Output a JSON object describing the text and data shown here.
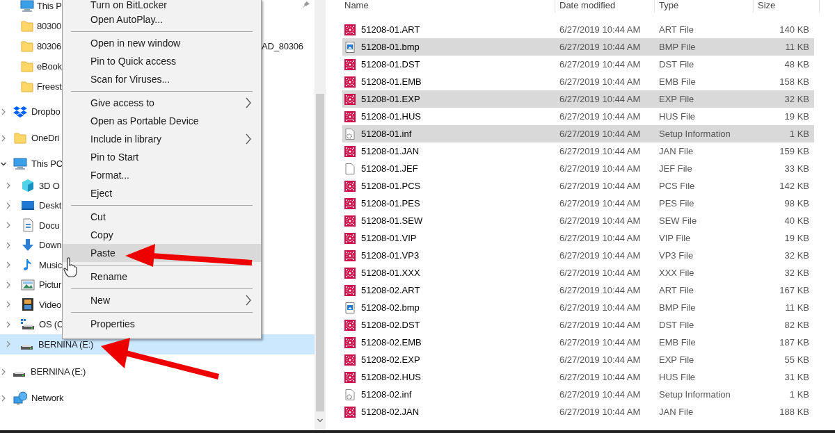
{
  "navigation": {
    "quick_access_items": [
      {
        "kind": "pc",
        "label": "This P"
      },
      {
        "kind": "folder",
        "label": "80300"
      },
      {
        "kind": "folder",
        "label": "80306",
        "tail": "AD_80306"
      },
      {
        "kind": "folder",
        "label": "eBook"
      },
      {
        "kind": "folder",
        "label": "Freest"
      }
    ],
    "tree": [
      {
        "kind": "dropbox",
        "label": "Dropbo",
        "expanded": false,
        "selected": false
      },
      {
        "kind": "folder",
        "label": "OneDri",
        "expanded": false,
        "selected": false
      },
      {
        "kind": "pc",
        "label": "This PC",
        "expanded": true,
        "selected": false,
        "children": [
          {
            "kind": "cube",
            "label": "3D O",
            "selected": false
          },
          {
            "kind": "desktop",
            "label": "Deskt",
            "selected": false
          },
          {
            "kind": "documents",
            "label": "Docu",
            "selected": false
          },
          {
            "kind": "downloads",
            "label": "Down",
            "selected": false
          },
          {
            "kind": "music",
            "label": "Music",
            "selected": false
          },
          {
            "kind": "pictures",
            "label": "Pictur",
            "selected": false
          },
          {
            "kind": "videos",
            "label": "Video",
            "selected": false
          },
          {
            "kind": "osdrive",
            "label": "OS (C",
            "selected": false
          },
          {
            "kind": "drive",
            "label": "BERNINA (E:)",
            "selected": true
          }
        ]
      },
      {
        "kind": "drive",
        "label": "BERNINA (E:)",
        "expanded": false,
        "selected": false
      },
      {
        "kind": "network",
        "label": "Network",
        "expanded": false,
        "selected": false
      }
    ]
  },
  "context_menu": [
    {
      "kind": "item",
      "label": "Turn on BitLocker",
      "submenu": false,
      "highlighted": false
    },
    {
      "kind": "item",
      "label": "Open AutoPlay...",
      "submenu": false,
      "highlighted": false
    },
    {
      "kind": "separator"
    },
    {
      "kind": "item",
      "label": "Open in new window",
      "submenu": false,
      "highlighted": false
    },
    {
      "kind": "item",
      "label": "Pin to Quick access",
      "submenu": false,
      "highlighted": false
    },
    {
      "kind": "item",
      "label": "Scan for Viruses...",
      "submenu": false,
      "highlighted": false
    },
    {
      "kind": "separator"
    },
    {
      "kind": "item",
      "label": "Give access to",
      "submenu": true,
      "highlighted": false
    },
    {
      "kind": "item",
      "label": "Open as Portable Device",
      "submenu": false,
      "highlighted": false
    },
    {
      "kind": "item",
      "label": "Include in library",
      "submenu": true,
      "highlighted": false
    },
    {
      "kind": "item",
      "label": "Pin to Start",
      "submenu": false,
      "highlighted": false
    },
    {
      "kind": "item",
      "label": "Format...",
      "submenu": false,
      "highlighted": false
    },
    {
      "kind": "item",
      "label": "Eject",
      "submenu": false,
      "highlighted": false
    },
    {
      "kind": "separator"
    },
    {
      "kind": "item",
      "label": "Cut",
      "submenu": false,
      "highlighted": false
    },
    {
      "kind": "item",
      "label": "Copy",
      "submenu": false,
      "highlighted": false
    },
    {
      "kind": "item",
      "label": "Paste",
      "submenu": false,
      "highlighted": true
    },
    {
      "kind": "separator"
    },
    {
      "kind": "item",
      "label": "Rename",
      "submenu": false,
      "highlighted": false
    },
    {
      "kind": "separator"
    },
    {
      "kind": "item",
      "label": "New",
      "submenu": true,
      "highlighted": false
    },
    {
      "kind": "separator"
    },
    {
      "kind": "item",
      "label": "Properties",
      "submenu": false,
      "highlighted": false
    }
  ],
  "file_list": {
    "columns": [
      "Name",
      "Date modified",
      "Type",
      "Size"
    ],
    "rows": [
      {
        "kind": "embroidery",
        "name": "51208-01.ART",
        "date": "6/27/2019 10:44 AM",
        "type": "ART File",
        "size": "140 KB",
        "selected": false
      },
      {
        "kind": "bitmap",
        "name": "51208-01.bmp",
        "date": "6/27/2019 10:44 AM",
        "type": "BMP File",
        "size": "11 KB",
        "selected": true
      },
      {
        "kind": "embroidery",
        "name": "51208-01.DST",
        "date": "6/27/2019 10:44 AM",
        "type": "DST File",
        "size": "48 KB",
        "selected": false
      },
      {
        "kind": "embroidery",
        "name": "51208-01.EMB",
        "date": "6/27/2019 10:44 AM",
        "type": "EMB File",
        "size": "158 KB",
        "selected": false
      },
      {
        "kind": "embroidery",
        "name": "51208-01.EXP",
        "date": "6/27/2019 10:44 AM",
        "type": "EXP File",
        "size": "32 KB",
        "selected": true
      },
      {
        "kind": "embroidery",
        "name": "51208-01.HUS",
        "date": "6/27/2019 10:44 AM",
        "type": "HUS File",
        "size": "19 KB",
        "selected": false
      },
      {
        "kind": "setup",
        "name": "51208-01.inf",
        "date": "6/27/2019 10:44 AM",
        "type": "Setup Information",
        "size": "1 KB",
        "selected": true
      },
      {
        "kind": "embroidery",
        "name": "51208-01.JAN",
        "date": "6/27/2019 10:44 AM",
        "type": "JAN File",
        "size": "159 KB",
        "selected": false
      },
      {
        "kind": "blank",
        "name": "51208-01.JEF",
        "date": "6/27/2019 10:44 AM",
        "type": "JEF File",
        "size": "33 KB",
        "selected": false
      },
      {
        "kind": "embroidery",
        "name": "51208-01.PCS",
        "date": "6/27/2019 10:44 AM",
        "type": "PCS File",
        "size": "142 KB",
        "selected": false
      },
      {
        "kind": "embroidery",
        "name": "51208-01.PES",
        "date": "6/27/2019 10:44 AM",
        "type": "PES File",
        "size": "98 KB",
        "selected": false
      },
      {
        "kind": "embroidery",
        "name": "51208-01.SEW",
        "date": "6/27/2019 10:44 AM",
        "type": "SEW File",
        "size": "40 KB",
        "selected": false
      },
      {
        "kind": "embroidery",
        "name": "51208-01.VIP",
        "date": "6/27/2019 10:44 AM",
        "type": "VIP File",
        "size": "19 KB",
        "selected": false
      },
      {
        "kind": "embroidery",
        "name": "51208-01.VP3",
        "date": "6/27/2019 10:44 AM",
        "type": "VP3 File",
        "size": "32 KB",
        "selected": false
      },
      {
        "kind": "embroidery",
        "name": "51208-01.XXX",
        "date": "6/27/2019 10:44 AM",
        "type": "XXX File",
        "size": "32 KB",
        "selected": false
      },
      {
        "kind": "embroidery",
        "name": "51208-02.ART",
        "date": "6/27/2019 10:44 AM",
        "type": "ART File",
        "size": "167 KB",
        "selected": false
      },
      {
        "kind": "bitmap",
        "name": "51208-02.bmp",
        "date": "6/27/2019 10:44 AM",
        "type": "BMP File",
        "size": "11 KB",
        "selected": false
      },
      {
        "kind": "embroidery",
        "name": "51208-02.DST",
        "date": "6/27/2019 10:44 AM",
        "type": "DST File",
        "size": "82 KB",
        "selected": false
      },
      {
        "kind": "embroidery",
        "name": "51208-02.EMB",
        "date": "6/27/2019 10:44 AM",
        "type": "EMB File",
        "size": "187 KB",
        "selected": false
      },
      {
        "kind": "embroidery",
        "name": "51208-02.EXP",
        "date": "6/27/2019 10:44 AM",
        "type": "EXP File",
        "size": "55 KB",
        "selected": false
      },
      {
        "kind": "embroidery",
        "name": "51208-02.HUS",
        "date": "6/27/2019 10:44 AM",
        "type": "HUS File",
        "size": "31 KB",
        "selected": false
      },
      {
        "kind": "setup",
        "name": "51208-02.inf",
        "date": "6/27/2019 10:44 AM",
        "type": "Setup Information",
        "size": "1 KB",
        "selected": false
      },
      {
        "kind": "embroidery",
        "name": "51208-02.JAN",
        "date": "6/27/2019 10:44 AM",
        "type": "JAN File",
        "size": "188 KB",
        "selected": false
      }
    ]
  }
}
